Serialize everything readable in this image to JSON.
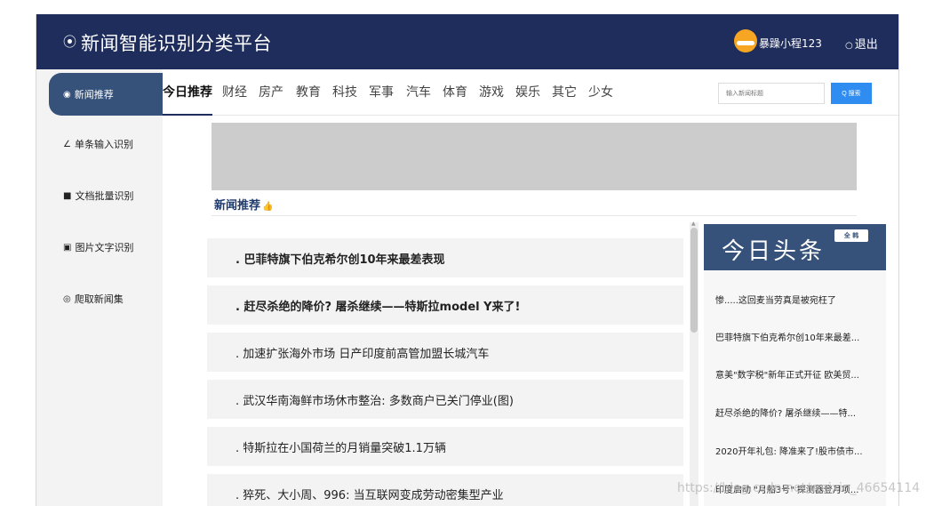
{
  "header": {
    "logo_glyph": "⦿",
    "title": "新闻智能识别分类平台",
    "username": "暴躁小程123",
    "logout_icon": "○",
    "logout_label": "退出"
  },
  "sidebar": {
    "items": [
      {
        "icon": "◉",
        "label": "新闻推荐"
      },
      {
        "icon": "∠",
        "label": "单条输入识别"
      },
      {
        "icon": "■",
        "label": "文档批量识别"
      },
      {
        "icon": "▣",
        "label": "图片文字识别"
      },
      {
        "icon": "◎",
        "label": "爬取新闻集"
      }
    ]
  },
  "tabs": [
    "今日推荐",
    "财经",
    "房产",
    "教育",
    "科技",
    "军事",
    "汽车",
    "体育",
    "游戏",
    "娱乐",
    "其它",
    "少女"
  ],
  "search": {
    "placeholder": "输入新闻标题",
    "button_label": "Q 搜索"
  },
  "recommend": {
    "label": "新闻推荐",
    "thumb": "👍"
  },
  "news_list": [
    ". 巴菲特旗下伯克希尔创10年来最差表现",
    ". 赶尽杀绝的降价? 屠杀继续——特斯拉model Y来了!",
    ". 加速扩张海外市场 日产印度前高管加盟长城汽车",
    ". 武汉华南海鲜市场休市整治: 多数商户已关门停业(图)",
    ". 特斯拉在小国荷兰的月销量突破1.1万辆",
    ". 猝死、大小周、996: 当互联网变成劳动密集型产业"
  ],
  "headlines": {
    "title": "今日头条",
    "badge": "全 韩",
    "items": [
      "惨.....这回麦当劳真是被宛枉了",
      "巴菲特旗下伯克希尔创10年来最差...",
      "意美\"数字税\"新年正式开征 欧美贸...",
      "赶尽杀绝的降价? 屠杀继续——特...",
      "2020开年礼包: 降准来了!股市债市...",
      "印度启动 \"月船3号\" 探测器登月项..."
    ]
  },
  "watermark": "https://blog.csdn.net/weixin_46654114",
  "colors": {
    "header_bg": "#1f2d5c",
    "sidebar_active": "#36527a",
    "search_button": "#2f8cf0",
    "banner": "#cccccc"
  }
}
